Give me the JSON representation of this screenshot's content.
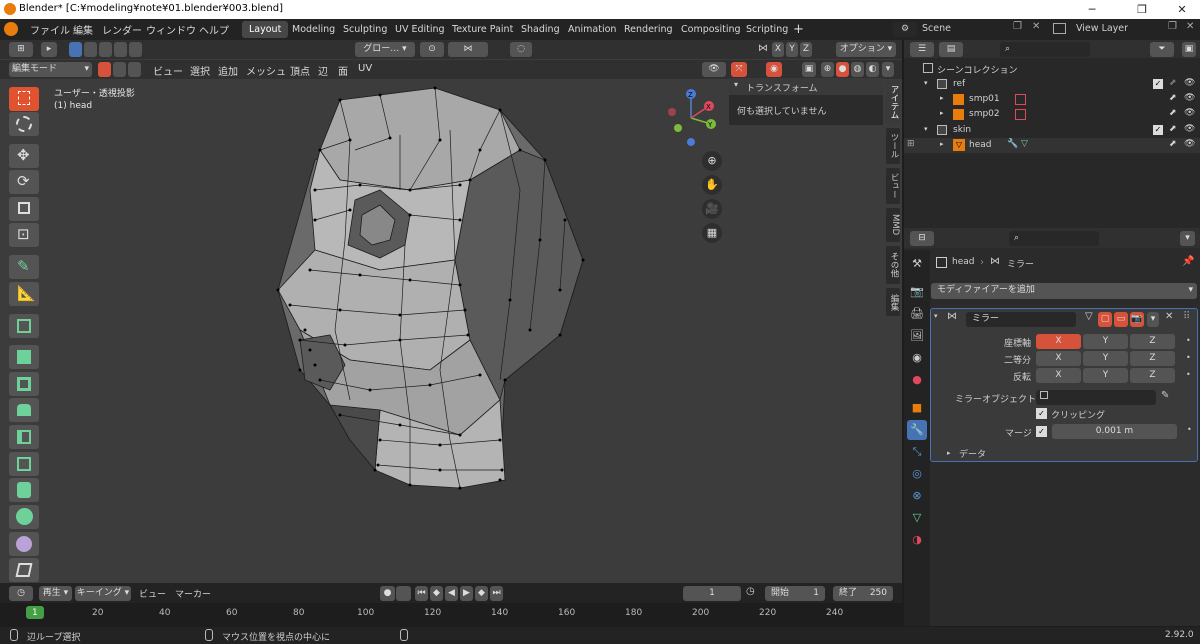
{
  "window": {
    "title": "Blender* [C:¥modeling¥note¥01.blender¥003.blend]",
    "minimize": "─",
    "maximize": "❐",
    "close": "✕"
  },
  "menu": [
    "ファイル",
    "編集",
    "レンダー",
    "ウィンドウ",
    "ヘルプ"
  ],
  "workspaces": [
    "Layout",
    "Modeling",
    "Sculpting",
    "UV Editing",
    "Texture Paint",
    "Shading",
    "Animation",
    "Rendering",
    "Compositing",
    "Scripting"
  ],
  "active_workspace": "Layout",
  "add_workspace": "+",
  "scene": {
    "name": "Scene",
    "view_layer": "View Layer"
  },
  "viewport": {
    "header": {
      "transform_orientation": "グロー…",
      "options": "オプション",
      "axes": [
        "X",
        "Y",
        "Z"
      ]
    },
    "mode": "編集モード",
    "menus": [
      "ビュー",
      "選択",
      "追加",
      "メッシュ",
      "頂点",
      "辺",
      "面",
      "UV"
    ],
    "overlay_text": {
      "view": "ユーザー・透視投影",
      "object": "(1) head"
    },
    "gizmo_axes": [
      "Z",
      "Y",
      "X"
    ],
    "npanel": {
      "section": "トランスフォーム",
      "empty_message": "何も選択していません"
    },
    "side_tabs": [
      "アイテム",
      "ツール",
      "ビュー",
      "MMD",
      "その他",
      "編集"
    ]
  },
  "outliner": {
    "title": "シーンコレクション",
    "rows": [
      {
        "name": "ref",
        "level": 1
      },
      {
        "name": "smp01",
        "level": 2
      },
      {
        "name": "smp02",
        "level": 2
      },
      {
        "name": "skin",
        "level": 1
      },
      {
        "name": "head",
        "level": 2
      }
    ]
  },
  "properties": {
    "breadcrumb": {
      "object": "head",
      "modifier": "ミラー"
    },
    "add_modifier": "モディファイアーを追加",
    "modifier": {
      "name": "ミラー",
      "axis_label": "座標軸",
      "bisect_label": "二等分",
      "flip_label": "反転",
      "axes": [
        "X",
        "Y",
        "Z"
      ],
      "mirror_object_label": "ミラーオブジェクト",
      "clipping_label": "クリッピング",
      "clipping_checked": true,
      "merge_label": "マージ",
      "merge_checked": true,
      "merge_value": "0.001 m",
      "data_label": "データ"
    }
  },
  "timeline": {
    "menus": [
      "再生",
      "キーイング",
      "ビュー",
      "マーカー"
    ],
    "current_frame": "1",
    "start_label": "開始",
    "start": "1",
    "end_label": "終了",
    "end": "250",
    "ticks": [
      "1",
      "20",
      "40",
      "60",
      "80",
      "100",
      "120",
      "140",
      "160",
      "180",
      "200",
      "220",
      "240"
    ]
  },
  "status": {
    "left": "辺ループ選択",
    "middle": "マウス位置を視点の中心に",
    "version": "2.92.0"
  },
  "colors": {
    "accent_orange": "#e1532f",
    "active_blue": "#4772b3",
    "mesh_light": "#b6b6b6",
    "mesh_dark": "#5e5e5e",
    "current_frame": "#45a045"
  }
}
